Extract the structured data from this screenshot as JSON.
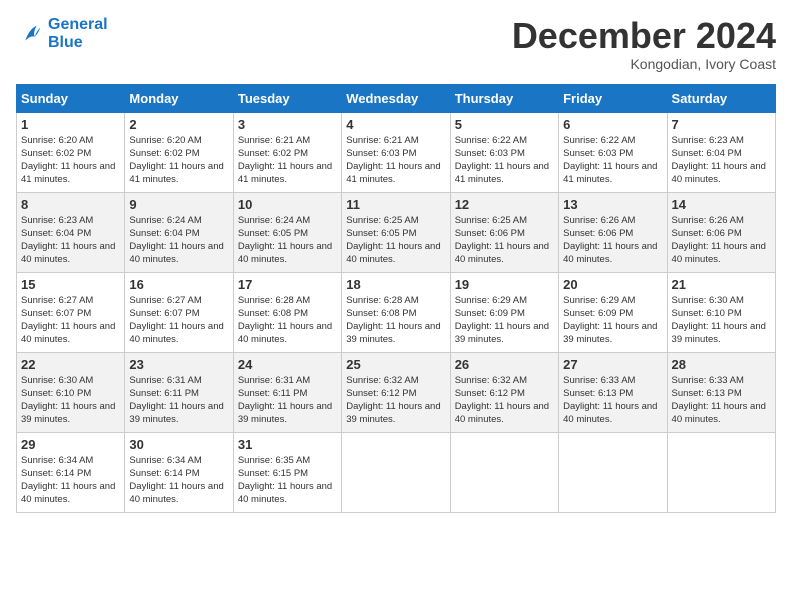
{
  "logo": {
    "line1": "General",
    "line2": "Blue"
  },
  "title": "December 2024",
  "location": "Kongodian, Ivory Coast",
  "days_header": [
    "Sunday",
    "Monday",
    "Tuesday",
    "Wednesday",
    "Thursday",
    "Friday",
    "Saturday"
  ],
  "weeks": [
    [
      {
        "day": "1",
        "sunrise": "6:20 AM",
        "sunset": "6:02 PM",
        "daylight": "11 hours and 41 minutes."
      },
      {
        "day": "2",
        "sunrise": "6:20 AM",
        "sunset": "6:02 PM",
        "daylight": "11 hours and 41 minutes."
      },
      {
        "day": "3",
        "sunrise": "6:21 AM",
        "sunset": "6:02 PM",
        "daylight": "11 hours and 41 minutes."
      },
      {
        "day": "4",
        "sunrise": "6:21 AM",
        "sunset": "6:03 PM",
        "daylight": "11 hours and 41 minutes."
      },
      {
        "day": "5",
        "sunrise": "6:22 AM",
        "sunset": "6:03 PM",
        "daylight": "11 hours and 41 minutes."
      },
      {
        "day": "6",
        "sunrise": "6:22 AM",
        "sunset": "6:03 PM",
        "daylight": "11 hours and 41 minutes."
      },
      {
        "day": "7",
        "sunrise": "6:23 AM",
        "sunset": "6:04 PM",
        "daylight": "11 hours and 40 minutes."
      }
    ],
    [
      {
        "day": "8",
        "sunrise": "6:23 AM",
        "sunset": "6:04 PM",
        "daylight": "11 hours and 40 minutes."
      },
      {
        "day": "9",
        "sunrise": "6:24 AM",
        "sunset": "6:04 PM",
        "daylight": "11 hours and 40 minutes."
      },
      {
        "day": "10",
        "sunrise": "6:24 AM",
        "sunset": "6:05 PM",
        "daylight": "11 hours and 40 minutes."
      },
      {
        "day": "11",
        "sunrise": "6:25 AM",
        "sunset": "6:05 PM",
        "daylight": "11 hours and 40 minutes."
      },
      {
        "day": "12",
        "sunrise": "6:25 AM",
        "sunset": "6:06 PM",
        "daylight": "11 hours and 40 minutes."
      },
      {
        "day": "13",
        "sunrise": "6:26 AM",
        "sunset": "6:06 PM",
        "daylight": "11 hours and 40 minutes."
      },
      {
        "day": "14",
        "sunrise": "6:26 AM",
        "sunset": "6:06 PM",
        "daylight": "11 hours and 40 minutes."
      }
    ],
    [
      {
        "day": "15",
        "sunrise": "6:27 AM",
        "sunset": "6:07 PM",
        "daylight": "11 hours and 40 minutes."
      },
      {
        "day": "16",
        "sunrise": "6:27 AM",
        "sunset": "6:07 PM",
        "daylight": "11 hours and 40 minutes."
      },
      {
        "day": "17",
        "sunrise": "6:28 AM",
        "sunset": "6:08 PM",
        "daylight": "11 hours and 40 minutes."
      },
      {
        "day": "18",
        "sunrise": "6:28 AM",
        "sunset": "6:08 PM",
        "daylight": "11 hours and 39 minutes."
      },
      {
        "day": "19",
        "sunrise": "6:29 AM",
        "sunset": "6:09 PM",
        "daylight": "11 hours and 39 minutes."
      },
      {
        "day": "20",
        "sunrise": "6:29 AM",
        "sunset": "6:09 PM",
        "daylight": "11 hours and 39 minutes."
      },
      {
        "day": "21",
        "sunrise": "6:30 AM",
        "sunset": "6:10 PM",
        "daylight": "11 hours and 39 minutes."
      }
    ],
    [
      {
        "day": "22",
        "sunrise": "6:30 AM",
        "sunset": "6:10 PM",
        "daylight": "11 hours and 39 minutes."
      },
      {
        "day": "23",
        "sunrise": "6:31 AM",
        "sunset": "6:11 PM",
        "daylight": "11 hours and 39 minutes."
      },
      {
        "day": "24",
        "sunrise": "6:31 AM",
        "sunset": "6:11 PM",
        "daylight": "11 hours and 39 minutes."
      },
      {
        "day": "25",
        "sunrise": "6:32 AM",
        "sunset": "6:12 PM",
        "daylight": "11 hours and 39 minutes."
      },
      {
        "day": "26",
        "sunrise": "6:32 AM",
        "sunset": "6:12 PM",
        "daylight": "11 hours and 40 minutes."
      },
      {
        "day": "27",
        "sunrise": "6:33 AM",
        "sunset": "6:13 PM",
        "daylight": "11 hours and 40 minutes."
      },
      {
        "day": "28",
        "sunrise": "6:33 AM",
        "sunset": "6:13 PM",
        "daylight": "11 hours and 40 minutes."
      }
    ],
    [
      {
        "day": "29",
        "sunrise": "6:34 AM",
        "sunset": "6:14 PM",
        "daylight": "11 hours and 40 minutes."
      },
      {
        "day": "30",
        "sunrise": "6:34 AM",
        "sunset": "6:14 PM",
        "daylight": "11 hours and 40 minutes."
      },
      {
        "day": "31",
        "sunrise": "6:35 AM",
        "sunset": "6:15 PM",
        "daylight": "11 hours and 40 minutes."
      },
      null,
      null,
      null,
      null
    ]
  ]
}
